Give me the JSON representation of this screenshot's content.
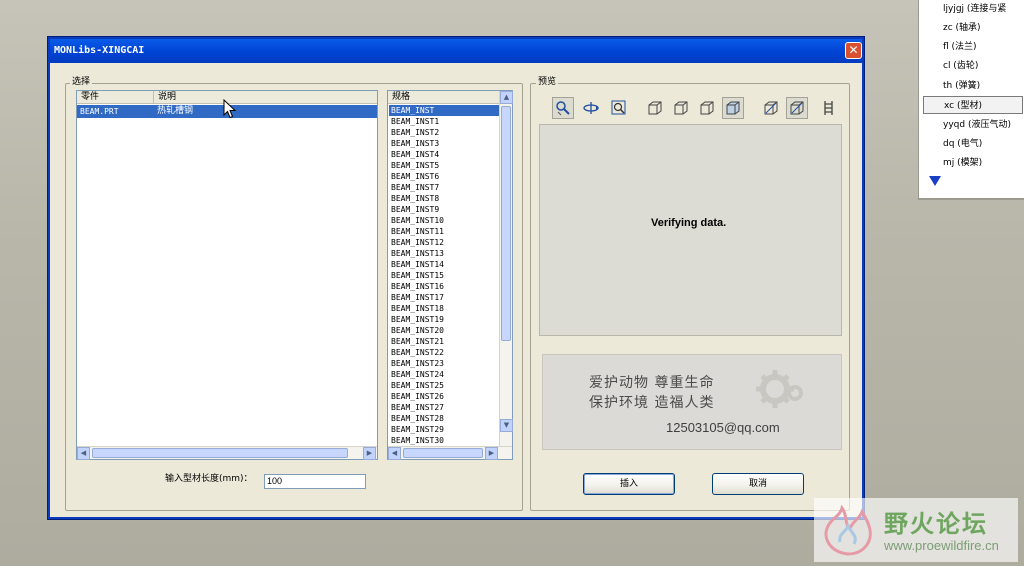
{
  "side_menu": {
    "items": [
      {
        "label": "ljyjgj (连接与紧",
        "selected": false
      },
      {
        "label": "zc (轴承)",
        "selected": false
      },
      {
        "label": "fl (法兰)",
        "selected": false
      },
      {
        "label": "cl (齿轮)",
        "selected": false
      },
      {
        "label": "th (弹簧)",
        "selected": false
      },
      {
        "label": "xc (型材)",
        "selected": true
      },
      {
        "label": "yyqd (液压气动)",
        "selected": false
      },
      {
        "label": "dq (电气)",
        "selected": false
      },
      {
        "label": "mj (模架)",
        "selected": false
      }
    ]
  },
  "window": {
    "title": "MONLibs-XINGCAI",
    "close_glyph": "✕"
  },
  "select_group": {
    "label": "选择",
    "parts_list": {
      "columns": [
        "零件",
        "说明"
      ],
      "rows": [
        {
          "part": "BEAM.PRT",
          "desc": "热轧槽钢",
          "selected": true
        }
      ]
    },
    "spec_list": {
      "header": "规格",
      "items": [
        "BEAM_INST",
        "BEAM_INST1",
        "BEAM_INST2",
        "BEAM_INST3",
        "BEAM_INST4",
        "BEAM_INST5",
        "BEAM_INST6",
        "BEAM_INST7",
        "BEAM_INST8",
        "BEAM_INST9",
        "BEAM_INST10",
        "BEAM_INST11",
        "BEAM_INST12",
        "BEAM_INST13",
        "BEAM_INST14",
        "BEAM_INST15",
        "BEAM_INST16",
        "BEAM_INST17",
        "BEAM_INST18",
        "BEAM_INST19",
        "BEAM_INST20",
        "BEAM_INST21",
        "BEAM_INST22",
        "BEAM_INST23",
        "BEAM_INST24",
        "BEAM_INST25",
        "BEAM_INST26",
        "BEAM_INST27",
        "BEAM_INST28",
        "BEAM_INST29",
        "BEAM_INST30"
      ],
      "selected_index": 0
    },
    "length_label": "输入型材长度(mm)：",
    "length_value": "100"
  },
  "preview_group": {
    "label": "预览",
    "toolbar_icons": [
      "zoom-pan-icon",
      "spin-icon",
      "zoom-window-icon",
      "wireframe-cube-icon",
      "hidden-line-cube-icon",
      "no-hidden-cube-icon",
      "shaded-cube-icon",
      "view-orient-icon",
      "saved-view-icon",
      "datum-display-icon"
    ],
    "message": "Verifying data.",
    "promo": {
      "line1": "爱护动物  尊重生命",
      "line2": "保护环境  造福人类",
      "email": "12503105@qq.com"
    }
  },
  "buttons": {
    "insert": "插入",
    "cancel": "取消"
  },
  "watermark": {
    "title": "野火论坛",
    "url": "www.proewildfire.cn"
  },
  "colors": {
    "selection": "#316ac5",
    "titlebar": "#0044d6",
    "dialog_bg": "#ece9d8"
  }
}
